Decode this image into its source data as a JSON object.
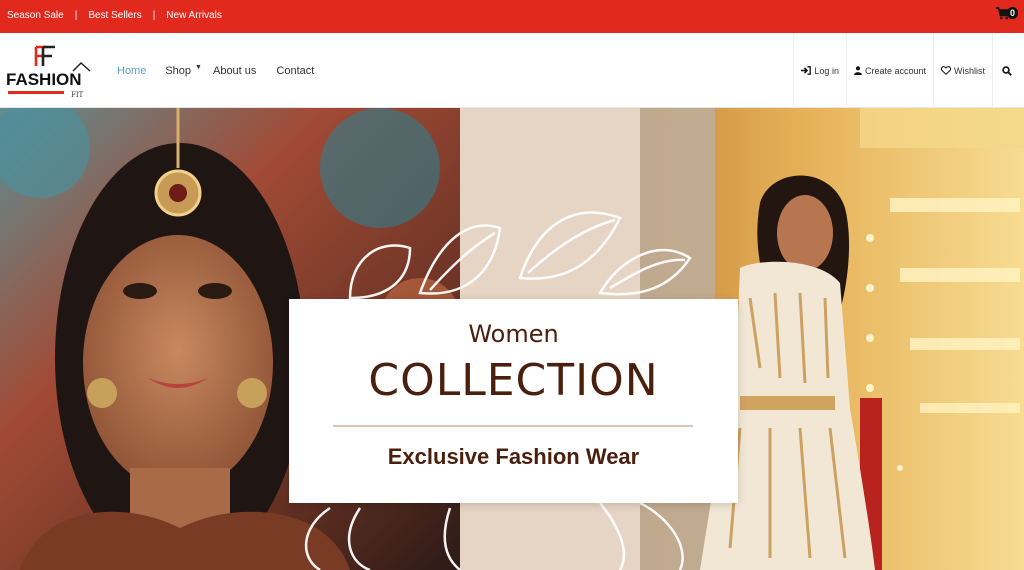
{
  "topbar": {
    "links": [
      "Season Sale",
      "Best Sellers",
      "New Arrivals"
    ],
    "separator": "|",
    "cart_count": "0",
    "background": "#e2291d"
  },
  "header": {
    "logo": {
      "mark": "FF",
      "word": "FASHION",
      "sub": "FIT"
    },
    "nav": {
      "home": "Home",
      "shop": "Shop",
      "about": "About us",
      "contact": "Contact"
    },
    "nav_active_color": "#5aa0c8",
    "account": {
      "login": "Log in",
      "create": "Create account",
      "wishlist": "Wishlist"
    }
  },
  "hero": {
    "title_small": "Women",
    "title_large": "COLLECTION",
    "tagline": "Exclusive Fashion Wear",
    "text_color": "#4a1f0e"
  }
}
